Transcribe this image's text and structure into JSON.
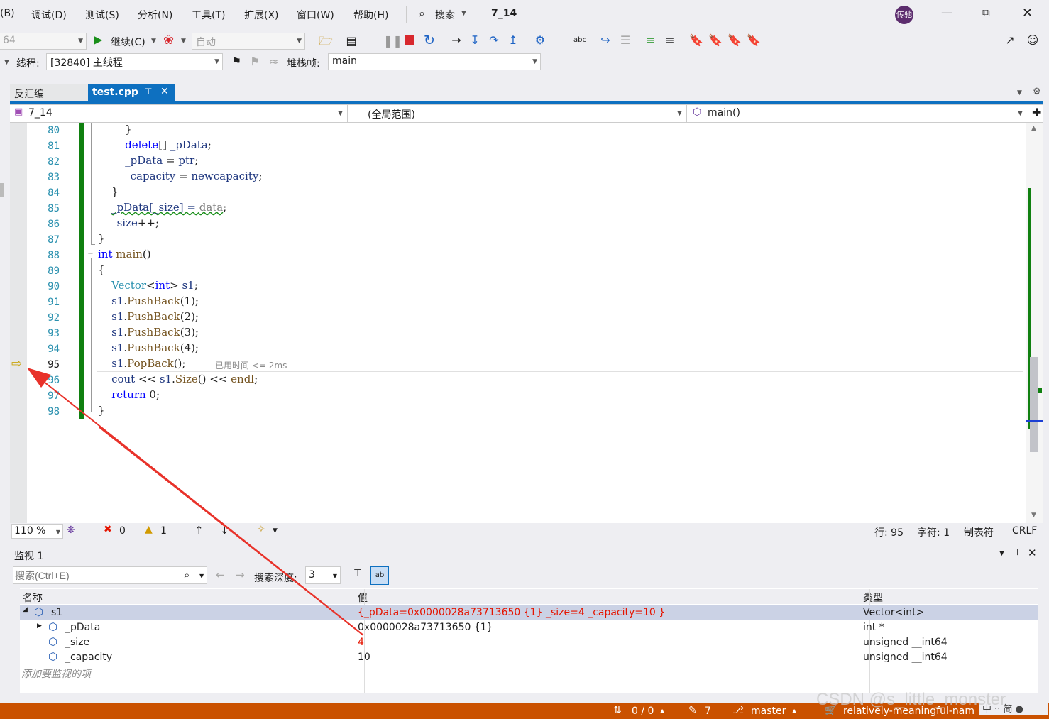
{
  "menu": {
    "items": [
      "(B)",
      "调试(D)",
      "测试(S)",
      "分析(N)",
      "工具(T)",
      "扩展(X)",
      "窗口(W)",
      "帮助(H)"
    ],
    "search_label": "搜索",
    "solution_name": "7_14",
    "avatar_text": "传驰"
  },
  "toolbar": {
    "platform_value": "64",
    "continue_label": "继续(C)",
    "auto_value": "自动"
  },
  "toolbar2": {
    "thread_label": "线程:",
    "thread_value": "[32840] 主线程",
    "stackframe_label": "堆栈帧:",
    "stackframe_value": "main"
  },
  "tabs": {
    "disasm": "反汇编",
    "active": "test.cpp"
  },
  "navbar": {
    "project": "7_14",
    "scope": "(全局范围)",
    "function": "main()"
  },
  "editor": {
    "line_numbers": [
      "80",
      "81",
      "82",
      "83",
      "84",
      "85",
      "86",
      "87",
      "88",
      "89",
      "90",
      "91",
      "92",
      "93",
      "94",
      "95",
      "96",
      "97",
      "98"
    ],
    "elapsed_hint": "已用时间 <= 2ms"
  },
  "editor_status": {
    "zoom": "110 %",
    "errors": "0",
    "warnings": "1",
    "line": "行: 95",
    "char": "字符: 1",
    "tabs": "制表符",
    "eol": "CRLF"
  },
  "watch": {
    "title": "监视 1",
    "search_placeholder": "搜索(Ctrl+E)",
    "depth_label": "搜索深度:",
    "depth_value": "3",
    "headers": {
      "name": "名称",
      "value": "值",
      "type": "类型"
    },
    "rows": [
      {
        "name": "s1",
        "value": "{_pData=0x0000028a73713650 {1} _size=4 _capacity=10 }",
        "type": "Vector<int>"
      },
      {
        "name": "_pData",
        "value": "0x0000028a73713650 {1}",
        "type": "int *"
      },
      {
        "name": "_size",
        "value": "4",
        "type": "unsigned __int64"
      },
      {
        "name": "_capacity",
        "value": "10",
        "type": "unsigned __int64"
      }
    ],
    "add_item": "添加要监视的项"
  },
  "statusbar": {
    "changes": "0 / 0",
    "commits": "7",
    "branch": "master",
    "repo": "relatively-meaningful-nam"
  },
  "watermark": "CSDN @s_little_monster",
  "colors": {
    "statusbar": "#ca5100",
    "keyword": "#0000ff",
    "type": "#2b91af",
    "changed_value": "#e51400",
    "change_bar": "#108010",
    "arrow": "#e8322a"
  }
}
